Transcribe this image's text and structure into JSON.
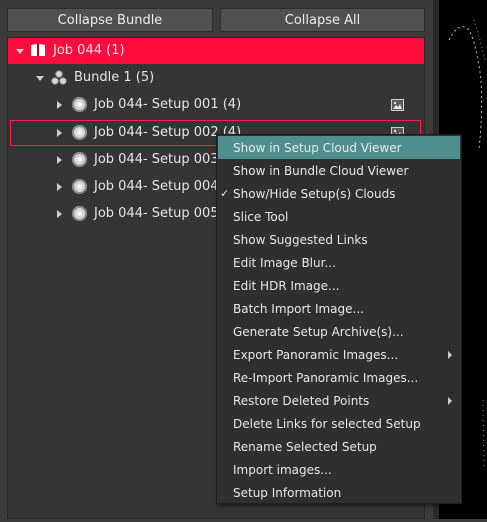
{
  "toolbar": {
    "collapse_bundle": "Collapse Bundle",
    "collapse_all": "Collapse All"
  },
  "tree": {
    "job": {
      "label": "Job 044 (1)"
    },
    "bundle": {
      "label": "Bundle 1 (5)"
    },
    "setups": [
      {
        "label": "Job 044- Setup 001 (4)"
      },
      {
        "label": "Job 044- Setup 002 (4)"
      },
      {
        "label": "Job 044- Setup 003 ("
      },
      {
        "label": "Job 044- Setup 004 ("
      },
      {
        "label": "Job 044- Setup 005 ("
      }
    ]
  },
  "context_menu": {
    "items": [
      {
        "label": "Show in Setup Cloud Viewer"
      },
      {
        "label": "Show in Bundle Cloud Viewer"
      },
      {
        "label": "Show/Hide Setup(s) Clouds",
        "checked": true,
        "check_mark": "✓"
      },
      {
        "label": "Slice Tool"
      },
      {
        "label": "Show Suggested Links"
      },
      {
        "label": "Edit Image Blur..."
      },
      {
        "label": "Edit HDR Image..."
      },
      {
        "label": "Batch Import Image..."
      },
      {
        "label": "Generate Setup Archive(s)..."
      },
      {
        "label": "Export Panoramic Images...",
        "submenu": true
      },
      {
        "label": "Re-Import Panoramic Images..."
      },
      {
        "label": "Restore Deleted Points",
        "submenu": true
      },
      {
        "label": "Delete Links for selected Setup"
      },
      {
        "label": "Rename Selected Setup"
      },
      {
        "label": "Import images..."
      },
      {
        "label": "Setup Information"
      }
    ]
  },
  "colors": {
    "selected_row": "#ff0c3f",
    "menu_active": "#4f8f8d",
    "highlight_outline": "#ff1f4d"
  }
}
